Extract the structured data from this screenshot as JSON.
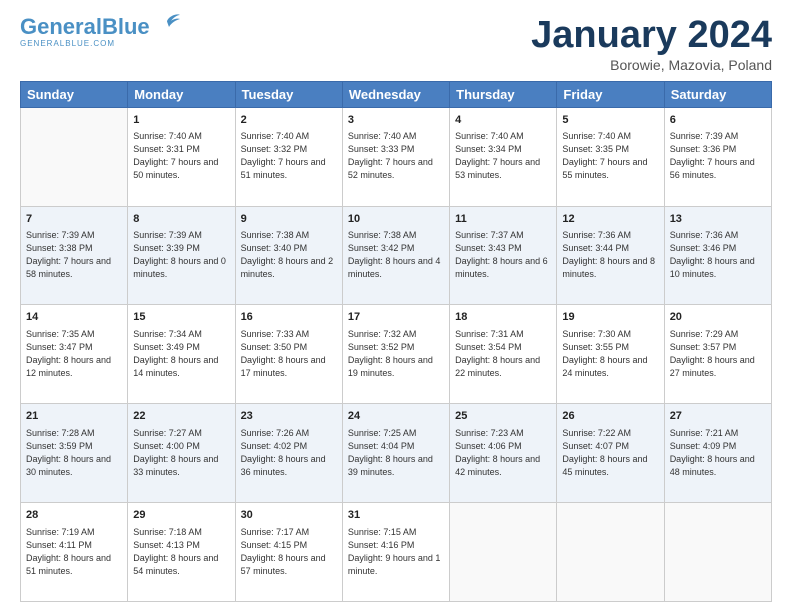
{
  "header": {
    "logo_line1": "General",
    "logo_line2": "Blue",
    "month": "January 2024",
    "location": "Borowie, Mazovia, Poland"
  },
  "days_of_week": [
    "Sunday",
    "Monday",
    "Tuesday",
    "Wednesday",
    "Thursday",
    "Friday",
    "Saturday"
  ],
  "weeks": [
    [
      {
        "day": "",
        "sunrise": "",
        "sunset": "",
        "daylight": ""
      },
      {
        "day": "1",
        "sunrise": "Sunrise: 7:40 AM",
        "sunset": "Sunset: 3:31 PM",
        "daylight": "Daylight: 7 hours and 50 minutes."
      },
      {
        "day": "2",
        "sunrise": "Sunrise: 7:40 AM",
        "sunset": "Sunset: 3:32 PM",
        "daylight": "Daylight: 7 hours and 51 minutes."
      },
      {
        "day": "3",
        "sunrise": "Sunrise: 7:40 AM",
        "sunset": "Sunset: 3:33 PM",
        "daylight": "Daylight: 7 hours and 52 minutes."
      },
      {
        "day": "4",
        "sunrise": "Sunrise: 7:40 AM",
        "sunset": "Sunset: 3:34 PM",
        "daylight": "Daylight: 7 hours and 53 minutes."
      },
      {
        "day": "5",
        "sunrise": "Sunrise: 7:40 AM",
        "sunset": "Sunset: 3:35 PM",
        "daylight": "Daylight: 7 hours and 55 minutes."
      },
      {
        "day": "6",
        "sunrise": "Sunrise: 7:39 AM",
        "sunset": "Sunset: 3:36 PM",
        "daylight": "Daylight: 7 hours and 56 minutes."
      }
    ],
    [
      {
        "day": "7",
        "sunrise": "Sunrise: 7:39 AM",
        "sunset": "Sunset: 3:38 PM",
        "daylight": "Daylight: 7 hours and 58 minutes."
      },
      {
        "day": "8",
        "sunrise": "Sunrise: 7:39 AM",
        "sunset": "Sunset: 3:39 PM",
        "daylight": "Daylight: 8 hours and 0 minutes."
      },
      {
        "day": "9",
        "sunrise": "Sunrise: 7:38 AM",
        "sunset": "Sunset: 3:40 PM",
        "daylight": "Daylight: 8 hours and 2 minutes."
      },
      {
        "day": "10",
        "sunrise": "Sunrise: 7:38 AM",
        "sunset": "Sunset: 3:42 PM",
        "daylight": "Daylight: 8 hours and 4 minutes."
      },
      {
        "day": "11",
        "sunrise": "Sunrise: 7:37 AM",
        "sunset": "Sunset: 3:43 PM",
        "daylight": "Daylight: 8 hours and 6 minutes."
      },
      {
        "day": "12",
        "sunrise": "Sunrise: 7:36 AM",
        "sunset": "Sunset: 3:44 PM",
        "daylight": "Daylight: 8 hours and 8 minutes."
      },
      {
        "day": "13",
        "sunrise": "Sunrise: 7:36 AM",
        "sunset": "Sunset: 3:46 PM",
        "daylight": "Daylight: 8 hours and 10 minutes."
      }
    ],
    [
      {
        "day": "14",
        "sunrise": "Sunrise: 7:35 AM",
        "sunset": "Sunset: 3:47 PM",
        "daylight": "Daylight: 8 hours and 12 minutes."
      },
      {
        "day": "15",
        "sunrise": "Sunrise: 7:34 AM",
        "sunset": "Sunset: 3:49 PM",
        "daylight": "Daylight: 8 hours and 14 minutes."
      },
      {
        "day": "16",
        "sunrise": "Sunrise: 7:33 AM",
        "sunset": "Sunset: 3:50 PM",
        "daylight": "Daylight: 8 hours and 17 minutes."
      },
      {
        "day": "17",
        "sunrise": "Sunrise: 7:32 AM",
        "sunset": "Sunset: 3:52 PM",
        "daylight": "Daylight: 8 hours and 19 minutes."
      },
      {
        "day": "18",
        "sunrise": "Sunrise: 7:31 AM",
        "sunset": "Sunset: 3:54 PM",
        "daylight": "Daylight: 8 hours and 22 minutes."
      },
      {
        "day": "19",
        "sunrise": "Sunrise: 7:30 AM",
        "sunset": "Sunset: 3:55 PM",
        "daylight": "Daylight: 8 hours and 24 minutes."
      },
      {
        "day": "20",
        "sunrise": "Sunrise: 7:29 AM",
        "sunset": "Sunset: 3:57 PM",
        "daylight": "Daylight: 8 hours and 27 minutes."
      }
    ],
    [
      {
        "day": "21",
        "sunrise": "Sunrise: 7:28 AM",
        "sunset": "Sunset: 3:59 PM",
        "daylight": "Daylight: 8 hours and 30 minutes."
      },
      {
        "day": "22",
        "sunrise": "Sunrise: 7:27 AM",
        "sunset": "Sunset: 4:00 PM",
        "daylight": "Daylight: 8 hours and 33 minutes."
      },
      {
        "day": "23",
        "sunrise": "Sunrise: 7:26 AM",
        "sunset": "Sunset: 4:02 PM",
        "daylight": "Daylight: 8 hours and 36 minutes."
      },
      {
        "day": "24",
        "sunrise": "Sunrise: 7:25 AM",
        "sunset": "Sunset: 4:04 PM",
        "daylight": "Daylight: 8 hours and 39 minutes."
      },
      {
        "day": "25",
        "sunrise": "Sunrise: 7:23 AM",
        "sunset": "Sunset: 4:06 PM",
        "daylight": "Daylight: 8 hours and 42 minutes."
      },
      {
        "day": "26",
        "sunrise": "Sunrise: 7:22 AM",
        "sunset": "Sunset: 4:07 PM",
        "daylight": "Daylight: 8 hours and 45 minutes."
      },
      {
        "day": "27",
        "sunrise": "Sunrise: 7:21 AM",
        "sunset": "Sunset: 4:09 PM",
        "daylight": "Daylight: 8 hours and 48 minutes."
      }
    ],
    [
      {
        "day": "28",
        "sunrise": "Sunrise: 7:19 AM",
        "sunset": "Sunset: 4:11 PM",
        "daylight": "Daylight: 8 hours and 51 minutes."
      },
      {
        "day": "29",
        "sunrise": "Sunrise: 7:18 AM",
        "sunset": "Sunset: 4:13 PM",
        "daylight": "Daylight: 8 hours and 54 minutes."
      },
      {
        "day": "30",
        "sunrise": "Sunrise: 7:17 AM",
        "sunset": "Sunset: 4:15 PM",
        "daylight": "Daylight: 8 hours and 57 minutes."
      },
      {
        "day": "31",
        "sunrise": "Sunrise: 7:15 AM",
        "sunset": "Sunset: 4:16 PM",
        "daylight": "Daylight: 9 hours and 1 minute."
      },
      {
        "day": "",
        "sunrise": "",
        "sunset": "",
        "daylight": ""
      },
      {
        "day": "",
        "sunrise": "",
        "sunset": "",
        "daylight": ""
      },
      {
        "day": "",
        "sunrise": "",
        "sunset": "",
        "daylight": ""
      }
    ]
  ]
}
